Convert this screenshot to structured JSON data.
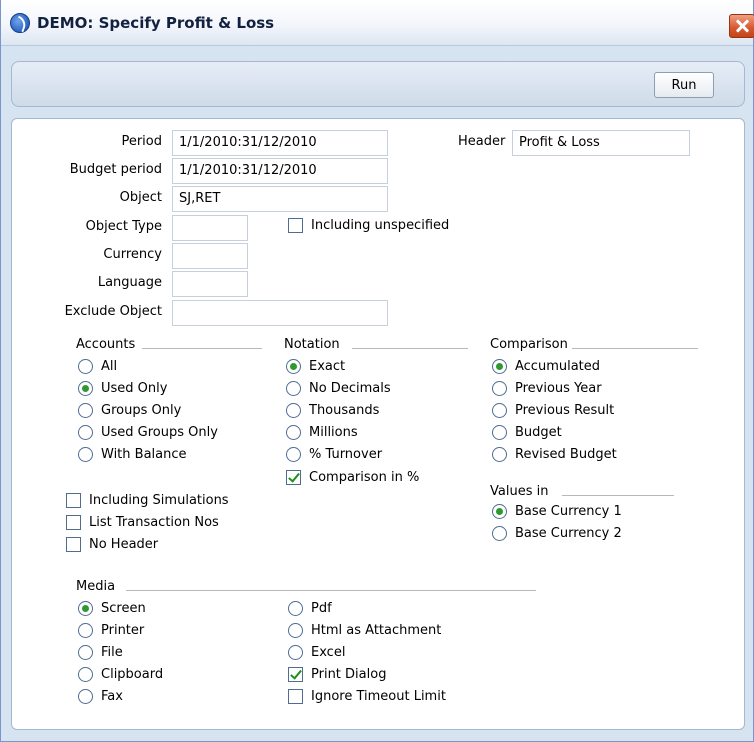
{
  "window": {
    "title": "DEMO: Specify Profit & Loss"
  },
  "toolbar": {
    "run_label": "Run"
  },
  "form": {
    "period_label": "Period",
    "period_value": "1/1/2010:31/12/2010",
    "budget_period_label": "Budget period",
    "budget_period_value": "1/1/2010:31/12/2010",
    "object_label": "Object",
    "object_value": "SJ,RET",
    "object_type_label": "Object Type",
    "object_type_value": "",
    "currency_label": "Currency",
    "currency_value": "",
    "language_label": "Language",
    "language_value": "",
    "exclude_object_label": "Exclude Object",
    "exclude_object_value": "",
    "header_label": "Header",
    "header_value": "Profit & Loss",
    "including_unspecified_label": "Including unspecified"
  },
  "accounts": {
    "title": "Accounts",
    "options": [
      {
        "label": "All",
        "selected": false
      },
      {
        "label": "Used Only",
        "selected": true
      },
      {
        "label": "Groups Only",
        "selected": false
      },
      {
        "label": "Used Groups Only",
        "selected": false
      },
      {
        "label": "With Balance",
        "selected": false
      }
    ]
  },
  "notation": {
    "title": "Notation",
    "options": [
      {
        "label": "Exact",
        "selected": true
      },
      {
        "label": "No Decimals",
        "selected": false
      },
      {
        "label": "Thousands",
        "selected": false
      },
      {
        "label": "Millions",
        "selected": false
      },
      {
        "label": "% Turnover",
        "selected": false
      }
    ],
    "comparison_pct_label": "Comparison in %",
    "comparison_pct_checked": true
  },
  "comparison": {
    "title": "Comparison",
    "options": [
      {
        "label": "Accumulated",
        "selected": true
      },
      {
        "label": "Previous Year",
        "selected": false
      },
      {
        "label": "Previous Result",
        "selected": false
      },
      {
        "label": "Budget",
        "selected": false
      },
      {
        "label": "Revised Budget",
        "selected": false
      }
    ]
  },
  "values_in": {
    "title": "Values in",
    "options": [
      {
        "label": "Base Currency 1",
        "selected": true
      },
      {
        "label": "Base Currency 2",
        "selected": false
      }
    ]
  },
  "flags": [
    {
      "label": "Including Simulations",
      "checked": false
    },
    {
      "label": "List Transaction Nos",
      "checked": false
    },
    {
      "label": "No Header",
      "checked": false
    }
  ],
  "media": {
    "title": "Media",
    "col1": [
      {
        "label": "Screen",
        "selected": true
      },
      {
        "label": "Printer",
        "selected": false
      },
      {
        "label": "File",
        "selected": false
      },
      {
        "label": "Clipboard",
        "selected": false
      },
      {
        "label": "Fax",
        "selected": false
      }
    ],
    "col2": [
      {
        "label": "Pdf",
        "selected": false
      },
      {
        "label": "Html as Attachment",
        "selected": false
      },
      {
        "label": "Excel",
        "selected": false
      }
    ],
    "print_dialog_label": "Print Dialog",
    "print_dialog_checked": true,
    "ignore_timeout_label": "Ignore Timeout Limit",
    "ignore_timeout_checked": false
  }
}
